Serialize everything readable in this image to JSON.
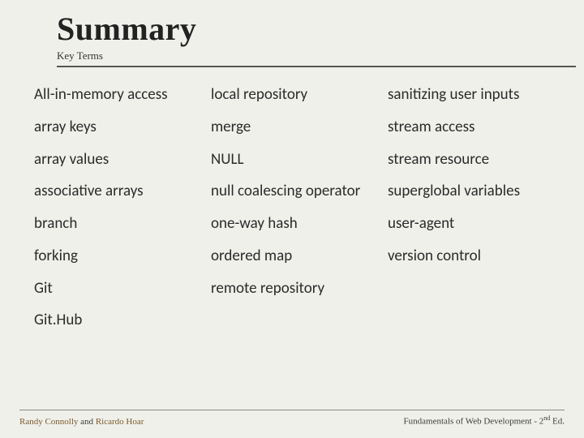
{
  "header": {
    "title": "Summary",
    "subtitle": "Key Terms"
  },
  "columns": {
    "c1": [
      "All-in-memory access",
      "array keys",
      "array values",
      "associative arrays",
      "branch",
      "forking",
      "Git",
      "Git.Hub"
    ],
    "c2": [
      "local repository",
      "merge",
      "NULL",
      "null coalescing operator",
      "one-way hash",
      "ordered map",
      "remote repository"
    ],
    "c3": [
      "sanitizing user inputs",
      "stream access",
      "stream resource",
      "superglobal variables",
      "user-agent",
      "version control"
    ]
  },
  "footer": {
    "author1": "Randy Connolly",
    "joiner": " and ",
    "author2": "Ricardo Hoar",
    "book_prefix": "Fundamentals of Web Development - 2",
    "book_sup": "nd",
    "book_suffix": " Ed."
  }
}
